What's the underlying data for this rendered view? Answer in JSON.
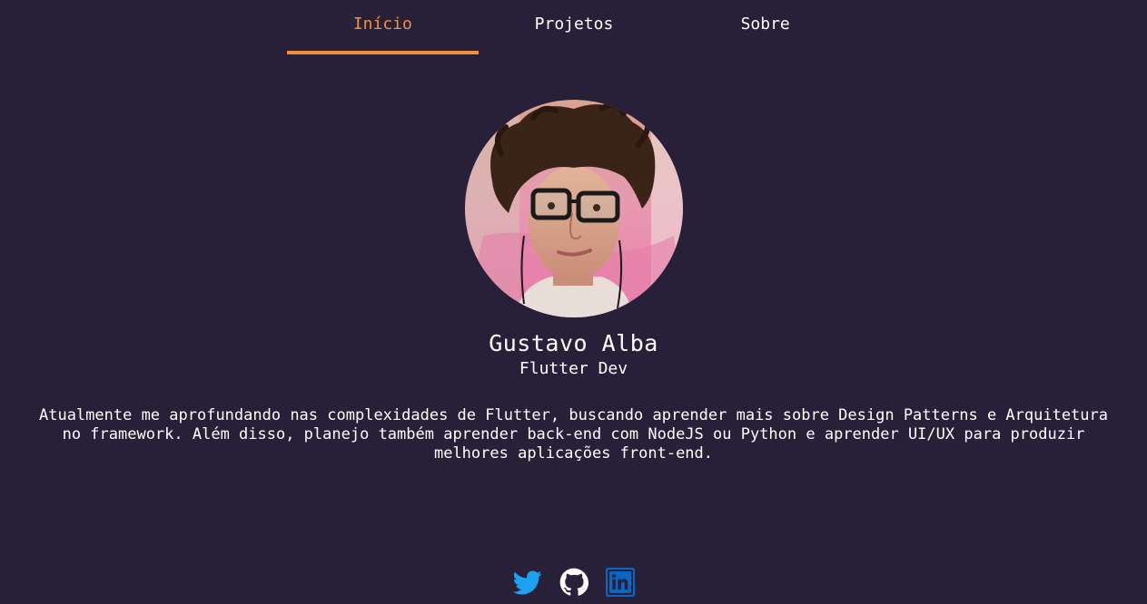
{
  "nav": {
    "tabs": [
      {
        "label": "Início",
        "active": true
      },
      {
        "label": "Projetos",
        "active": false
      },
      {
        "label": "Sobre",
        "active": false
      }
    ],
    "active_color": "#f0913f"
  },
  "profile": {
    "avatar_icon": "profile-photo",
    "name": "Gustavo Alba",
    "role": "Flutter Dev",
    "bio": "Atualmente me aprofundando nas complexidades de Flutter, buscando aprender mais sobre Design Patterns e Arquitetura no framework. Além disso, planejo também aprender back-end com NodeJS ou Python e aprender UI/UX para produzir melhores aplicações front-end."
  },
  "socials": [
    {
      "icon": "twitter-icon",
      "color": "#1da1f2"
    },
    {
      "icon": "github-icon",
      "color": "#ffffff"
    },
    {
      "icon": "linkedin-icon",
      "color": "#0a66c2"
    }
  ],
  "colors": {
    "background": "#281f39",
    "accent": "#f28d3a",
    "text": "#ffffff"
  }
}
